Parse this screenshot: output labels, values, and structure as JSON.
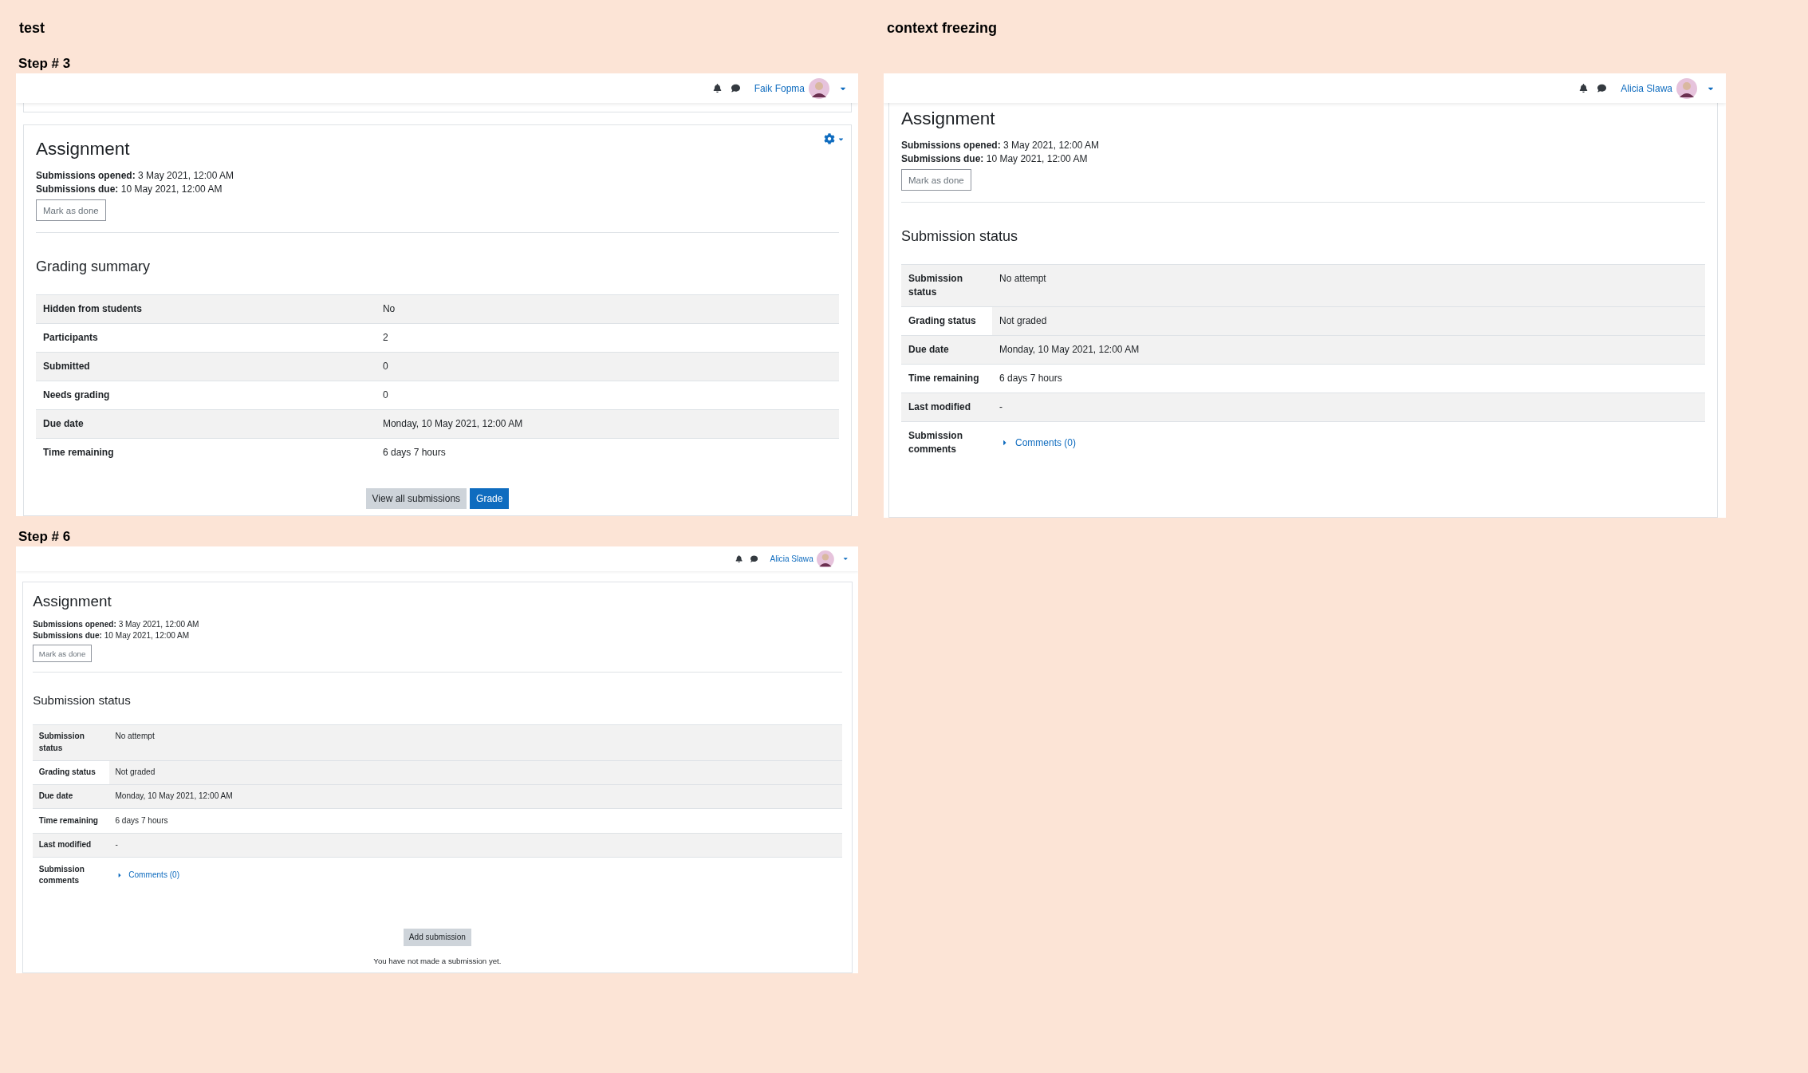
{
  "columns": [
    {
      "heading": "test",
      "steps": [
        {
          "label": "Step # 3",
          "screen": {
            "user": {
              "name": "Faik Fopma"
            },
            "card_fragment_above": true,
            "settings_menu": true,
            "title": "Assignment",
            "dates": [
              {
                "label": "Submissions opened:",
                "value": "3 May 2021, 12:00 AM"
              },
              {
                "label": "Submissions due:",
                "value": "10 May 2021, 12:00 AM"
              }
            ],
            "mark_done": "Mark as done",
            "section": {
              "kind": "summary",
              "title": "Grading summary",
              "rows": [
                {
                  "label": "Hidden from students",
                  "value": "No",
                  "kind": "text"
                },
                {
                  "label": "Participants",
                  "value": "2",
                  "kind": "text"
                },
                {
                  "label": "Submitted",
                  "value": "0",
                  "kind": "text"
                },
                {
                  "label": "Needs grading",
                  "value": "0",
                  "kind": "text"
                },
                {
                  "label": "Due date",
                  "value": "Monday, 10 May 2021, 12:00 AM",
                  "kind": "text"
                },
                {
                  "label": "Time remaining",
                  "value": "6 days 7 hours",
                  "kind": "text"
                }
              ]
            },
            "buttons": [
              {
                "label": "View all submissions",
                "kind": "secondary"
              },
              {
                "label": "Grade",
                "kind": "primary"
              }
            ]
          }
        },
        {
          "label": "Step # 6",
          "screen": {
            "user": {
              "name": "Alicia Slawa"
            },
            "title": "Assignment",
            "dates": [
              {
                "label": "Submissions opened:",
                "value": "3 May 2021, 12:00 AM"
              },
              {
                "label": "Submissions due:",
                "value": "10 May 2021, 12:00 AM"
              }
            ],
            "mark_done": "Mark as done",
            "section": {
              "kind": "status",
              "title": "Submission status",
              "rows": [
                {
                  "label": "Submission status",
                  "value": "No attempt",
                  "kind": "text"
                },
                {
                  "label": "Grading status",
                  "value": "Not graded",
                  "kind": "text",
                  "value_shaded": true
                },
                {
                  "label": "Due date",
                  "value": "Monday, 10 May 2021, 12:00 AM",
                  "kind": "text"
                },
                {
                  "label": "Time remaining",
                  "value": "6 days 7 hours",
                  "kind": "text"
                },
                {
                  "label": "Last modified",
                  "value": "-",
                  "kind": "text"
                },
                {
                  "label": "Submission comments",
                  "value": "Comments (0)",
                  "kind": "link"
                }
              ]
            },
            "buttons": [
              {
                "label": "Add submission",
                "kind": "secondary"
              }
            ],
            "note": "You have not made a submission yet."
          }
        }
      ]
    },
    {
      "heading": "context freezing",
      "steps": [
        {
          "screen": {
            "user": {
              "name": "Alicia Slawa"
            },
            "title": "Assignment",
            "dates": [
              {
                "label": "Submissions opened:",
                "value": "3 May 2021, 12:00 AM"
              },
              {
                "label": "Submissions due:",
                "value": "10 May 2021, 12:00 AM"
              }
            ],
            "mark_done": "Mark as done",
            "section": {
              "kind": "status",
              "title": "Submission status",
              "rows": [
                {
                  "label": "Submission status",
                  "value": "No attempt",
                  "kind": "text"
                },
                {
                  "label": "Grading status",
                  "value": "Not graded",
                  "kind": "text",
                  "value_shaded": true
                },
                {
                  "label": "Due date",
                  "value": "Monday, 10 May 2021, 12:00 AM",
                  "kind": "text"
                },
                {
                  "label": "Time remaining",
                  "value": "6 days 7 hours",
                  "kind": "text"
                },
                {
                  "label": "Last modified",
                  "value": "-",
                  "kind": "text"
                },
                {
                  "label": "Submission comments",
                  "value": "Comments (0)",
                  "kind": "link"
                }
              ]
            }
          }
        }
      ]
    }
  ]
}
